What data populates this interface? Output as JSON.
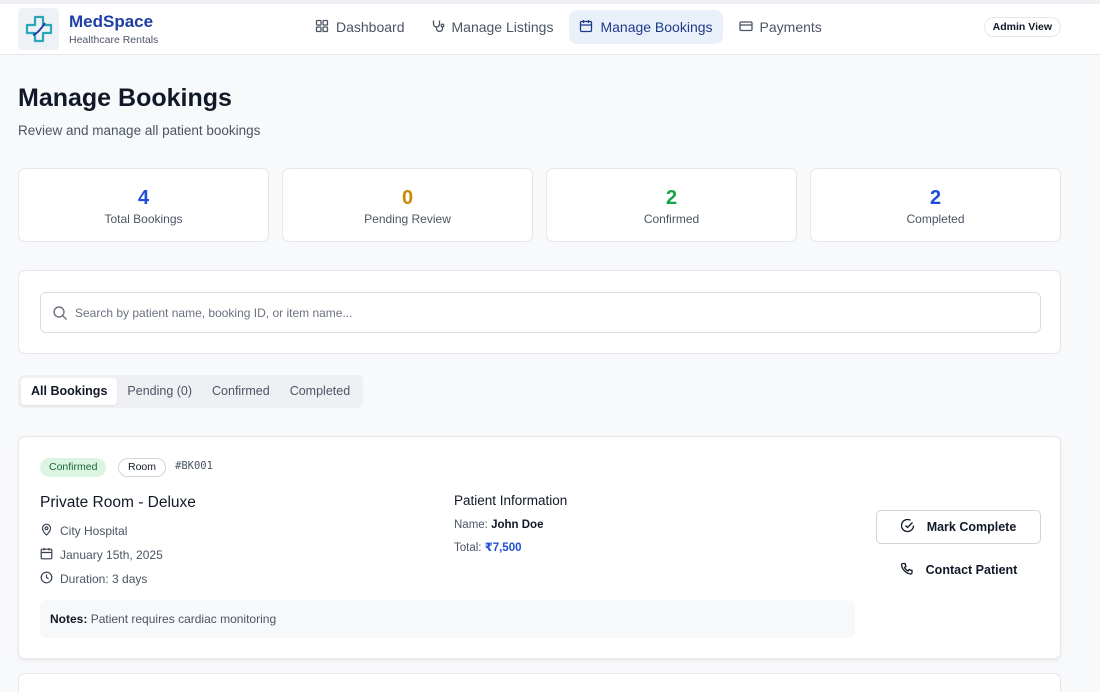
{
  "brand": {
    "name": "MedSpace",
    "subtitle": "Healthcare Rentals",
    "accent": "#1d3fa6"
  },
  "nav": {
    "items": [
      {
        "label": "Dashboard",
        "icon": "grid-icon"
      },
      {
        "label": "Manage Listings",
        "icon": "stethoscope-icon"
      },
      {
        "label": "Manage Bookings",
        "icon": "calendar-icon",
        "active": true
      },
      {
        "label": "Payments",
        "icon": "credit-card-icon"
      }
    ],
    "admin_badge": "Admin View"
  },
  "page": {
    "title": "Manage Bookings",
    "subtitle": "Review and manage all patient bookings"
  },
  "stats": [
    {
      "value": "4",
      "label": "Total Bookings",
      "color": "#1d4ed8"
    },
    {
      "value": "0",
      "label": "Pending Review",
      "color": "#ca8a04"
    },
    {
      "value": "2",
      "label": "Confirmed",
      "color": "#16a34a"
    },
    {
      "value": "2",
      "label": "Completed",
      "color": "#1d4ed8"
    }
  ],
  "search": {
    "placeholder": "Search by patient name, booking ID, or item name...",
    "value": ""
  },
  "tabs": [
    {
      "label": "All Bookings",
      "active": true
    },
    {
      "label": "Pending (0)"
    },
    {
      "label": "Confirmed"
    },
    {
      "label": "Completed"
    }
  ],
  "booking": {
    "status": "Confirmed",
    "type": "Room",
    "id": "#BK001",
    "title": "Private Room - Deluxe",
    "location": "City Hospital",
    "date": "January 15th, 2025",
    "duration": "Duration: 3 days",
    "patient_heading": "Patient Information",
    "name_label": "Name:",
    "name_value": "John Doe",
    "total_label": "Total:",
    "total_value": "₹7,500",
    "notes_label": "Notes:",
    "notes_value": "Patient requires cardiac monitoring",
    "actions": {
      "complete": "Mark Complete",
      "contact": "Contact Patient"
    }
  }
}
